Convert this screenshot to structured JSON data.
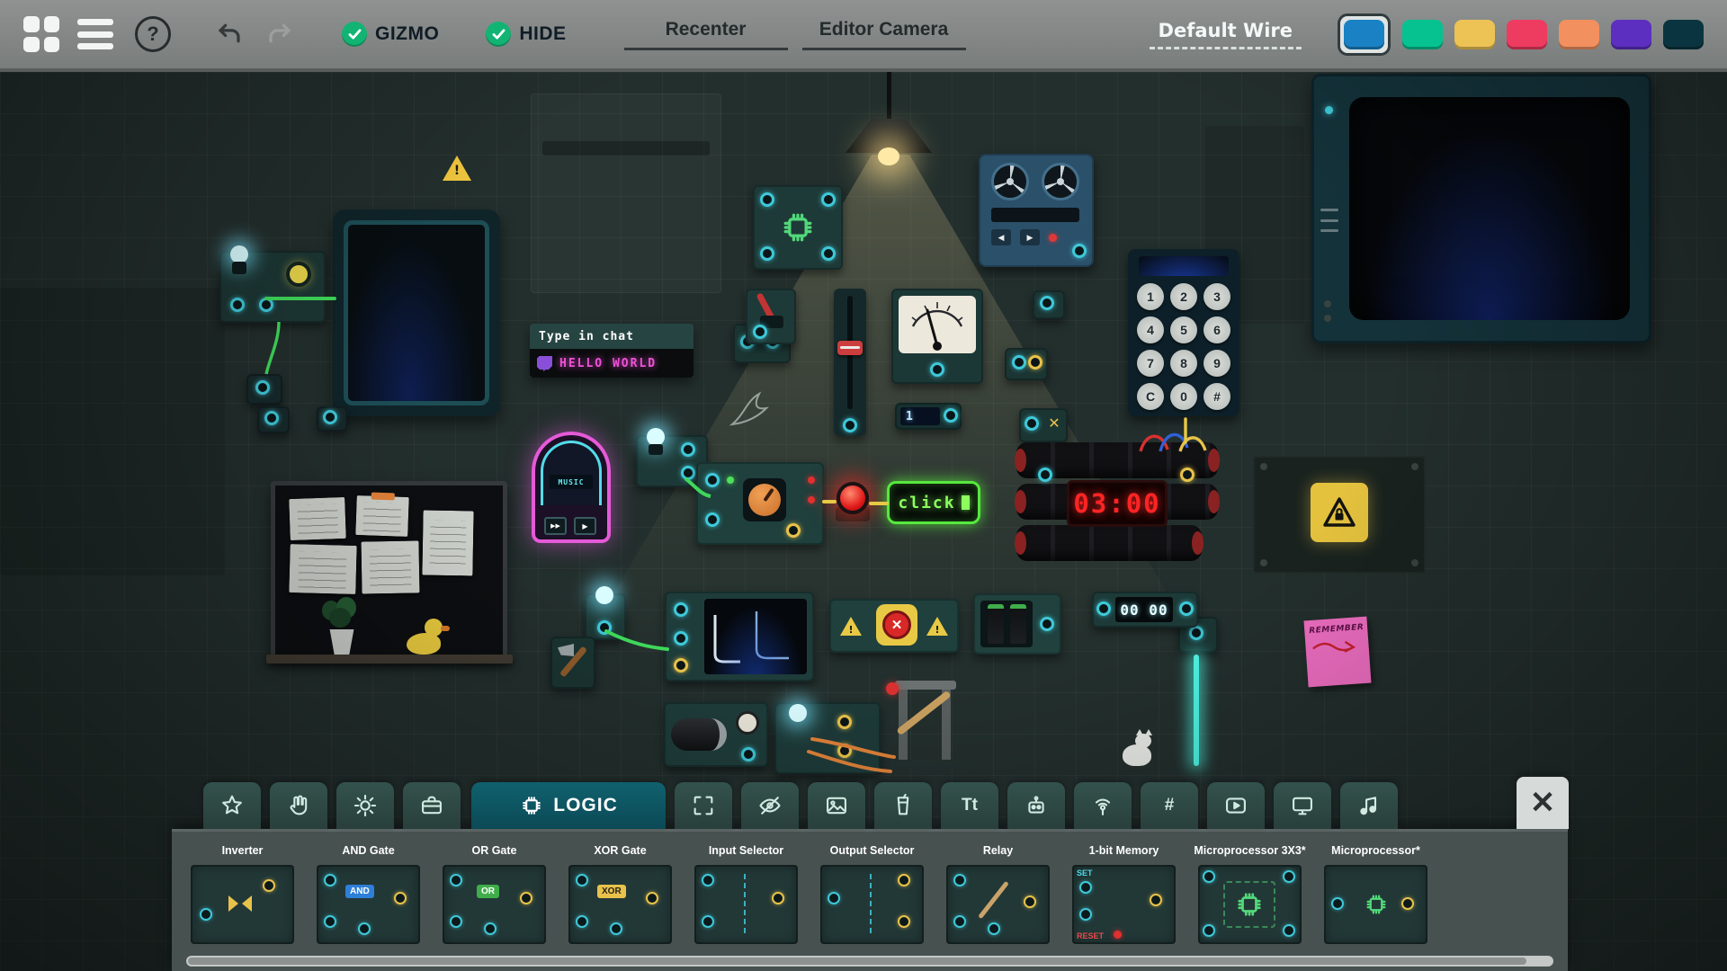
{
  "toolbar": {
    "help": "?",
    "gizmo": "GIZMO",
    "hide": "HIDE",
    "recenter": "Recenter",
    "editor_camera": "Editor Camera",
    "default_wire": "Default Wire",
    "wire_colors": [
      "#1a82c4",
      "#06c290",
      "#edc355",
      "#ee3b60",
      "#f29060",
      "#5c2fc0",
      "#0a3540"
    ]
  },
  "canvas": {
    "chat_sign_header": "Type in chat",
    "chat_sign_message": "HELLO WORLD",
    "jukebox_screen": "MUSIC",
    "click_sign": "click",
    "bomb_timer": "03:00",
    "counter_display": "00 00",
    "gauge_display": "1",
    "sticky_note": "REMEMBER",
    "keypad": [
      "1",
      "2",
      "3",
      "4",
      "5",
      "6",
      "7",
      "8",
      "9",
      "C",
      "0",
      "#"
    ]
  },
  "icons": {
    "warning": "!",
    "close": "✕",
    "x_button": "✕",
    "play": "▶",
    "skip": "▶▶",
    "rewind": "◀"
  },
  "tabbar": {
    "logic": "LOGIC",
    "text_tab": "Tt",
    "hash_tab": "#"
  },
  "panel": {
    "items": [
      {
        "label": "Inverter"
      },
      {
        "label": "AND Gate",
        "badge": "AND"
      },
      {
        "label": "OR Gate",
        "badge": "OR"
      },
      {
        "label": "XOR Gate",
        "badge": "XOR"
      },
      {
        "label": "Input Selector"
      },
      {
        "label": "Output Selector"
      },
      {
        "label": "Relay"
      },
      {
        "label": "1-bit Memory",
        "set": "SET",
        "reset": "RESET"
      },
      {
        "label": "Microprocessor 3X3*"
      },
      {
        "label": "Microprocessor*"
      }
    ]
  }
}
